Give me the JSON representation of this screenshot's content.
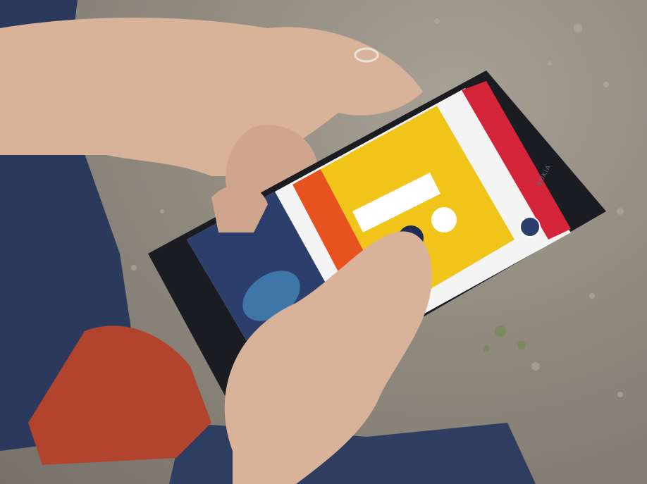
{
  "image": {
    "description_tags": [
      "hands",
      "smartphone",
      "gravel-ground",
      "denim-jeans",
      "red-shoes"
    ]
  },
  "phone": {
    "brand": "NOKIA",
    "screen": {
      "app_title": "",
      "promo_text": ""
    }
  },
  "colors": {
    "ground": "#8f897e",
    "denim": "#2b3a5c",
    "skin": "#d9b29a",
    "phone_body": "#1b1c22",
    "screen_yellow": "#f0c419",
    "screen_orange": "#e8521f",
    "screen_red": "#d3243a",
    "screen_navy": "#2c3e6b",
    "shoe_red": "#b2432c"
  }
}
